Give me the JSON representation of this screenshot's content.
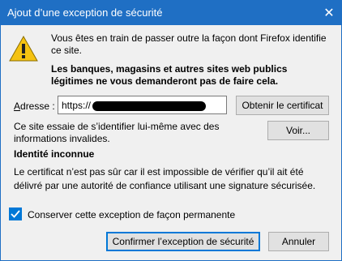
{
  "window": {
    "title": "Ajout d’une exception de sécurité",
    "close_glyph": "✕"
  },
  "message": {
    "intro": "Vous êtes en train de passer outre la façon dont Firefox identifie ce site.",
    "warning": "Les banques, magasins et autres sites web publics légitimes ne vous demanderont pas de faire cela."
  },
  "address": {
    "label": "Adresse :",
    "value": "https://"
  },
  "buttons": {
    "get_certificate": "Obtenir le certificat",
    "view": "Voir...",
    "confirm": "Confirmer l’exception de sécurité",
    "cancel": "Annuler"
  },
  "status": {
    "info": "Ce site essaie de s’identifier lui-même avec des informations invalides.",
    "heading": "Identité inconnue",
    "description": "Le certificat n’est pas sûr car il est impossible de vérifier qu’il ait été délivré par une autorité de confiance utilisant une signature sécurisée."
  },
  "permanent": {
    "label": "Conserver cette exception de façon permanente",
    "checked": true
  },
  "icons": {
    "warning": "warning-triangle-icon",
    "close": "close-icon",
    "check": "checkmark-icon"
  },
  "colors": {
    "titlebar": "#1f6fc4",
    "accent": "#0078d7",
    "warning_yellow": "#f5c211"
  }
}
